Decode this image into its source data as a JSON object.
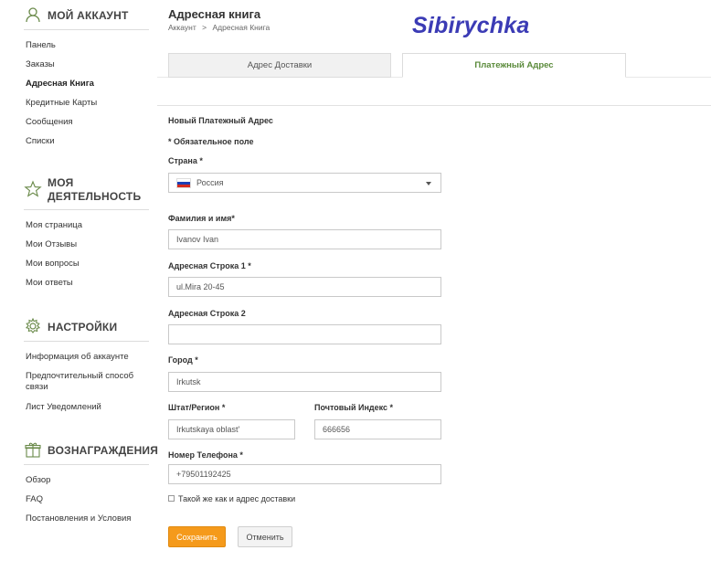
{
  "sidebar": {
    "account": {
      "title": "МОЙ АККАУНТ",
      "icon": "user-icon",
      "items": [
        "Панель",
        "Заказы",
        "Адресная Книга",
        "Кредитные Карты",
        "Сообщения",
        "Списки"
      ]
    },
    "activity": {
      "title_line1": "МОЯ",
      "title_line2": "ДЕЯТЕЛЬНОСТЬ",
      "icon": "star-icon",
      "items": [
        "Моя страница",
        "Мои Отзывы",
        "Мои вопросы",
        "Мои ответы"
      ]
    },
    "settings": {
      "title": "НАСТРОЙКИ",
      "icon": "gear-icon",
      "items": [
        "Информация об аккаунте",
        "Предпочтительный способ связи",
        "Лист Уведомлений"
      ]
    },
    "rewards": {
      "title": "ВОЗНАГРАЖДЕНИЯ",
      "icon": "gift-icon",
      "items": [
        "Обзор",
        "FAQ",
        "Постановления и Условия"
      ]
    }
  },
  "header": {
    "title": "Адресная книга",
    "breadcrumb": [
      "Аккаунт",
      ">",
      "Адресная Книга"
    ],
    "watermark": "Sibirychka"
  },
  "tabs": {
    "shipping": "Адрес Доставки",
    "billing": "Платежный Адрес"
  },
  "form": {
    "heading": "Новый Платежный Адрес",
    "required_note": "* Обязательное поле",
    "country": {
      "label": "Страна *",
      "value": "Россия"
    },
    "full_name": {
      "label": "Фамилия и имя*",
      "value": "Ivanov Ivan"
    },
    "address1": {
      "label": "Адресная Строка 1 *",
      "value": "ul.Mira 20-45"
    },
    "address2": {
      "label": "Адресная Строка 2",
      "value": ""
    },
    "city": {
      "label": "Город *",
      "value": "Irkutsk"
    },
    "state": {
      "label": "Штат/Регион *",
      "value": "Irkutskaya oblast'"
    },
    "postal": {
      "label": "Почтовый Индекс *",
      "value": "666656"
    },
    "phone": {
      "label": "Номер Телефона *",
      "value": "+79501192425"
    },
    "same_as_shipping": "Такой же как и адрес доставки",
    "save": "Сохранить",
    "cancel": "Отменить"
  },
  "colors": {
    "accent_orange": "#f59a1b",
    "tab_active_green": "#5a8a3a",
    "watermark_blue": "#3b3bb5",
    "icon_green": "#6a8a4a"
  }
}
